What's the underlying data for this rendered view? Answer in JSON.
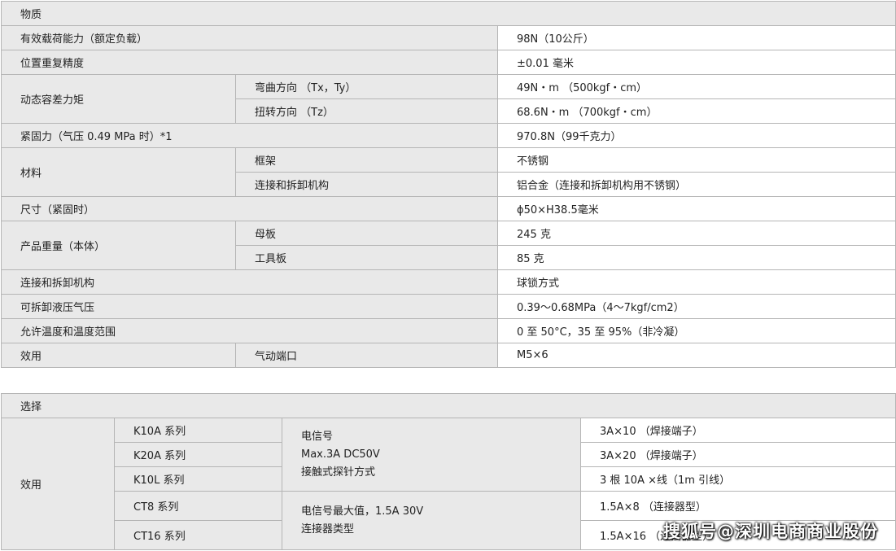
{
  "spec_table": {
    "header": "物质",
    "rows": {
      "payload_label": "有效载荷能力（额定负载）",
      "payload_value": "98N（10公斤）",
      "repeatability_label": "位置重复精度",
      "repeatability_value": "±0.01 毫米",
      "moment_label": "动态容差力矩",
      "moment_bend_label": "弯曲方向 （Tx，Ty）",
      "moment_bend_value": "49N・m （500kgf・cm）",
      "moment_torsion_label": "扭转方向 （Tz）",
      "moment_torsion_value": "68.6N・m （700kgf・cm）",
      "clamp_label": "紧固力（气压 0.49 MPa 时）*1",
      "clamp_value": "970.8N（99千克力）",
      "material_label": "材料",
      "material_frame_label": "框架",
      "material_frame_value": "不锈钢",
      "material_mech_label": "连接和拆卸机构",
      "material_mech_value": "铝合金（连接和拆卸机构用不锈钢）",
      "size_label": "尺寸（紧固时）",
      "size_value": "ϕ50×H38.5毫米",
      "weight_label": "产品重量（本体）",
      "weight_master_label": "母板",
      "weight_master_value": "245 克",
      "weight_tool_label": "工具板",
      "weight_tool_value": "85 克",
      "mech_label": "连接和拆卸机构",
      "mech_value": "球锁方式",
      "pressure_label": "可拆卸液压气压",
      "pressure_value": "0.39～0.68MPa（4～7kgf/cm2）",
      "env_label": "允许温度和温度范围",
      "env_value": "0 至 50°C，35 至 95%（非冷凝）",
      "util_label": "效用",
      "util_port_label": "气动端口",
      "util_port_value": "M5×6"
    }
  },
  "option_table": {
    "header": "选择",
    "util_label": "效用",
    "series": [
      "K10A 系列",
      "K20A 系列",
      "K10L 系列",
      "CT8 系列",
      "CT16 系列"
    ],
    "group1_lines": [
      "电信号",
      "Max.3A DC50V",
      "接触式探针方式"
    ],
    "group2_lines": [
      "电信号最大值，1.5A 30V",
      "连接器类型"
    ],
    "values": [
      "3A×10 （焊接端子）",
      "3A×20 （焊接端子）",
      "3 根 10A ×线（1m 引线）",
      "1.5A×8 （连接器型）",
      "1.5A×16 （连接器型）"
    ]
  },
  "watermark": "搜狐号@深圳电商商业股份"
}
